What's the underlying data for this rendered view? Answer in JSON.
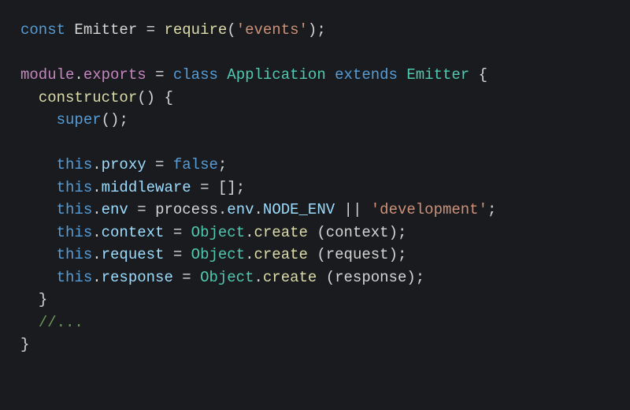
{
  "code": {
    "l1": {
      "const": "const",
      "Emitter": "Emitter",
      "eq": "=",
      "require": "require",
      "lp": "(",
      "str": "'events'",
      "rp": ")",
      "semi": ";"
    },
    "l3": {
      "module": "module",
      "dot": ".",
      "exports": "exports",
      "eq": "=",
      "class": "class",
      "Application": "Application",
      "extends": "extends",
      "Emitter": "Emitter",
      "brace": "{"
    },
    "l4": {
      "constructor": "constructor",
      "parens": "()",
      "brace": "{"
    },
    "l5": {
      "super": "super",
      "parens": "()",
      "semi": ";"
    },
    "l7": {
      "this": "this",
      "dot": ".",
      "proxy": "proxy",
      "eq": "=",
      "false": "false",
      "semi": ";"
    },
    "l8": {
      "this": "this",
      "dot": ".",
      "middleware": "middleware",
      "eq": "=",
      "brackets": "[]",
      "semi": ";"
    },
    "l9": {
      "this": "this",
      "dot1": ".",
      "env": "env",
      "eq": "=",
      "process": "process",
      "dot2": ".",
      "penv": "env",
      "dot3": ".",
      "NODE_ENV": "NODE_ENV",
      "or": "||",
      "str": "'development'",
      "semi": ";"
    },
    "l10": {
      "this": "this",
      "dot1": ".",
      "context": "context",
      "eq": "=",
      "Object": "Object",
      "dot2": ".",
      "create": "create",
      "sp": " ",
      "lp": "(",
      "arg": "context",
      "rp": ")",
      "semi": ";"
    },
    "l11": {
      "this": "this",
      "dot1": ".",
      "request": "request",
      "eq": "=",
      "Object": "Object",
      "dot2": ".",
      "create": "create",
      "sp": " ",
      "lp": "(",
      "arg": "request",
      "rp": ")",
      "semi": ";"
    },
    "l12": {
      "this": "this",
      "dot1": ".",
      "response": "response",
      "eq": "=",
      "Object": "Object",
      "dot2": ".",
      "create": "create",
      "sp": " ",
      "lp": "(",
      "arg": "response",
      "rp": ")",
      "semi": ";"
    },
    "l13": {
      "brace": "}"
    },
    "l14": {
      "comment": "//..."
    },
    "l15": {
      "brace": "}"
    }
  }
}
